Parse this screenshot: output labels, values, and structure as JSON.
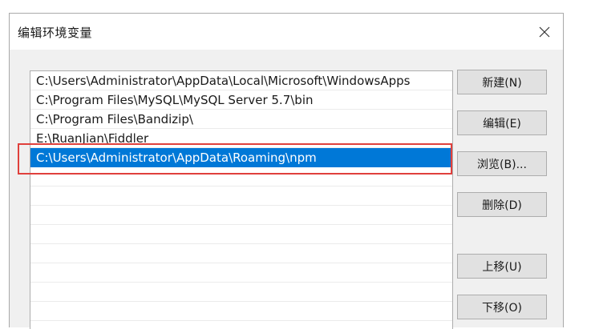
{
  "dialog": {
    "title": "编辑环境变量"
  },
  "paths": [
    "C:\\Users\\Administrator\\AppData\\Local\\Microsoft\\WindowsApps",
    "C:\\Program Files\\MySQL\\MySQL Server 5.7\\bin",
    "C:\\Program Files\\Bandizip\\",
    "E:\\RuanJian\\Fiddler",
    "C:\\Users\\Administrator\\AppData\\Roaming\\npm"
  ],
  "selected_index": 4,
  "buttons": {
    "new": "新建(N)",
    "edit": "编辑(E)",
    "browse": "浏览(B)...",
    "delete": "删除(D)",
    "move_up": "上移(U)",
    "move_down": "下移(O)"
  },
  "colors": {
    "selection": "#0078d7",
    "annotation": "#e0403c"
  }
}
